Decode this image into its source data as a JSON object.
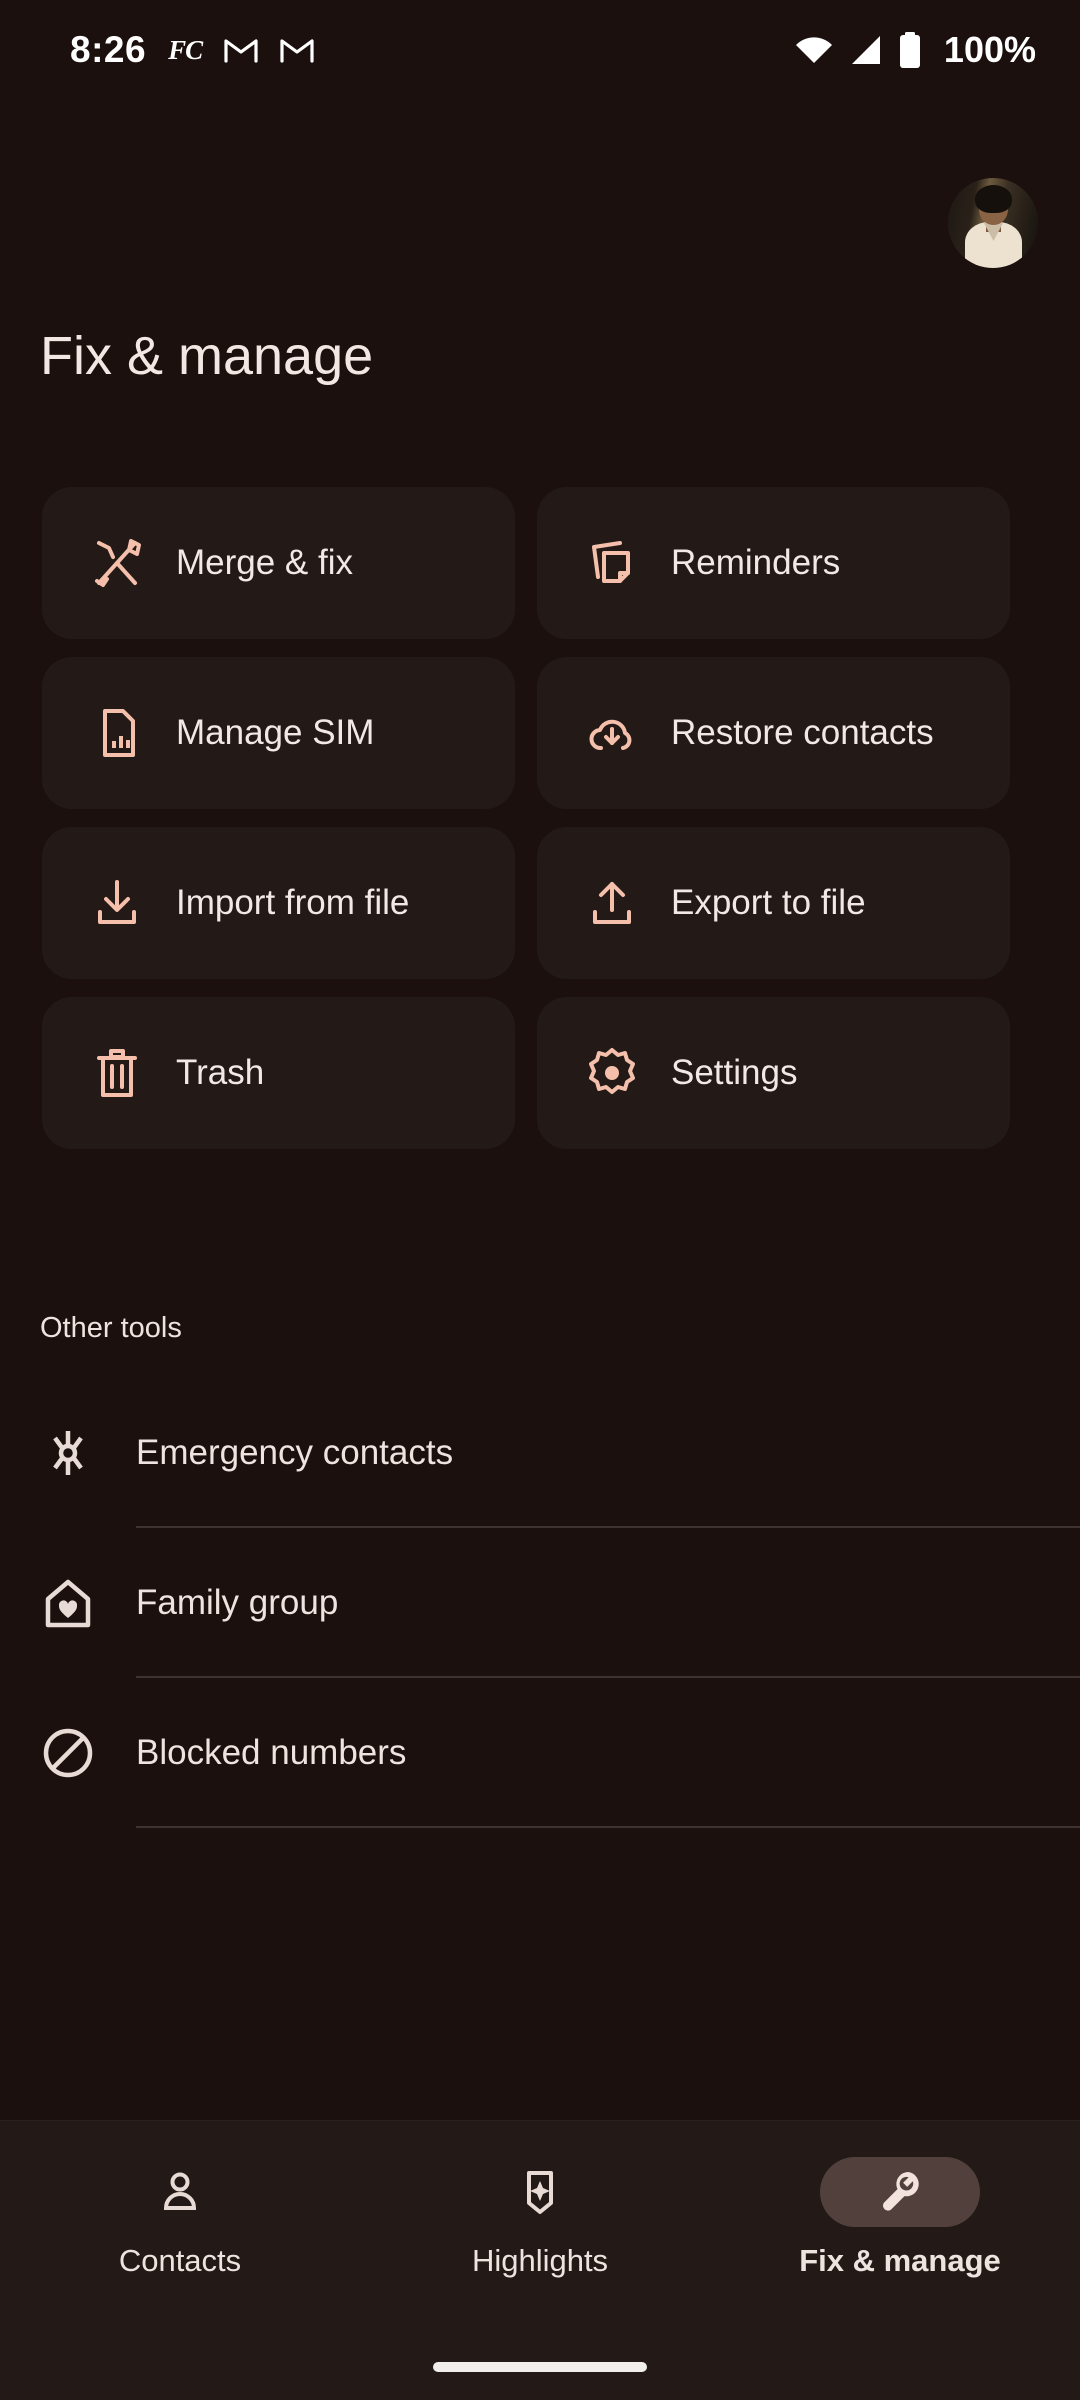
{
  "statusbar": {
    "time": "8:26",
    "fc_badge": "FC",
    "notif_icons": [
      "fc-icon",
      "gmail-icon",
      "gmail-icon"
    ],
    "wifi_icon": "wifi-icon",
    "signal_icon": "cellular-signal-icon",
    "battery_icon": "battery-full-icon",
    "battery_percent": "100%"
  },
  "header": {
    "title": "Fix & manage",
    "avatar_name": "account-avatar"
  },
  "colors": {
    "background": "#1b100e",
    "surface": "#231a17",
    "accent": "#f5c0ab",
    "on_surface": "#f2e9e6",
    "active_pill": "#51403b",
    "divider": "#40332f"
  },
  "tiles": [
    {
      "label": "Merge & fix",
      "icon": "merge-fix-icon"
    },
    {
      "label": "Reminders",
      "icon": "reminders-icon"
    },
    {
      "label": "Manage SIM",
      "icon": "sim-card-icon"
    },
    {
      "label": "Restore contacts",
      "icon": "cloud-download-icon"
    },
    {
      "label": "Import from file",
      "icon": "import-download-icon"
    },
    {
      "label": "Export to file",
      "icon": "export-upload-icon"
    },
    {
      "label": "Trash",
      "icon": "trash-icon"
    },
    {
      "label": "Settings",
      "icon": "gear-icon"
    }
  ],
  "other_tools": {
    "heading": "Other tools",
    "items": [
      {
        "label": "Emergency contacts",
        "icon": "star-of-life-icon"
      },
      {
        "label": "Family group",
        "icon": "home-heart-icon"
      },
      {
        "label": "Blocked numbers",
        "icon": "block-circle-icon"
      }
    ]
  },
  "bottom_nav": {
    "items": [
      {
        "label": "Contacts",
        "icon": "person-icon",
        "active": false
      },
      {
        "label": "Highlights",
        "icon": "sparkle-icon",
        "active": false
      },
      {
        "label": "Fix & manage",
        "icon": "wrench-icon",
        "active": true
      }
    ]
  }
}
